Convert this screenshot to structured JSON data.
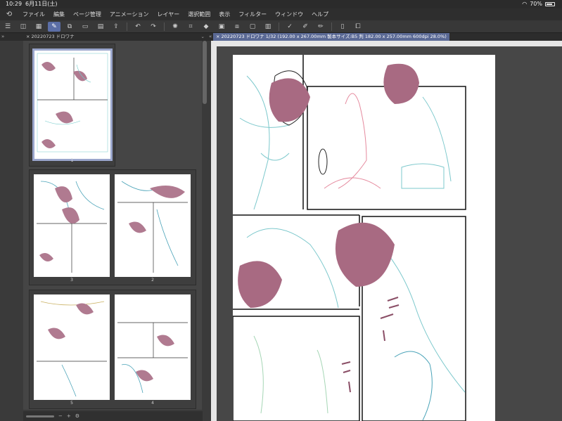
{
  "status": {
    "time": "10:29",
    "date": "6月11日(土)",
    "battery": "70%"
  },
  "menu": {
    "items": [
      "ファイル",
      "編集",
      "ページ管理",
      "アニメーション",
      "レイヤー",
      "選択範囲",
      "表示",
      "フィルター",
      "ウィンドウ",
      "ヘルプ"
    ]
  },
  "toolbar": {
    "icons": [
      "menu-icon",
      "view-icon",
      "story-icon",
      "brush-icon",
      "copy-icon",
      "folder-icon",
      "save-icon",
      "export-icon",
      "undo-icon",
      "redo-icon",
      "transform-icon",
      "crop-icon",
      "fill-icon",
      "layer-icon",
      "duplicate-icon",
      "clear-icon",
      "ruler-icon",
      "checkmark-pen-icon",
      "pen-icon",
      "pen-alt-icon",
      "device-icon",
      "pages-icon"
    ]
  },
  "tabs": {
    "left": "20220723 ドロワナ",
    "right": "20220723 ドロワナ 1/32 (192.00 x 267.00mm 製本サイズ:B5 判 182.00 x 257.00mm 600dpi 28.0%)"
  },
  "pages": {
    "labels": [
      "1",
      "3",
      "2",
      "5",
      "4"
    ]
  },
  "colors": {
    "accent": "#5a6995",
    "panel": "#454545",
    "sketch": "#6cc3c7",
    "mask": "#a86a82"
  }
}
